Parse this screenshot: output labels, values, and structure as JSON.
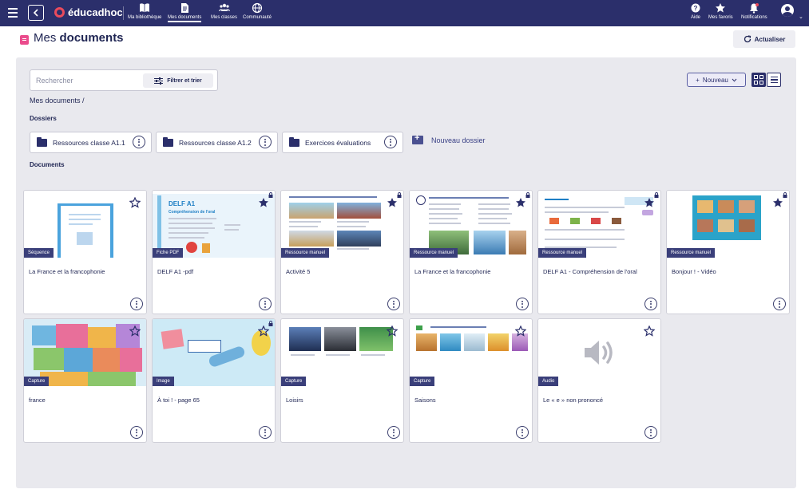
{
  "navbar": {
    "brand": "éducadhoc",
    "items": [
      {
        "label": "Ma bibliothèque",
        "icon": "book-icon"
      },
      {
        "label": "Mes documents",
        "icon": "document-icon"
      },
      {
        "label": "Mes classes",
        "icon": "users-icon"
      },
      {
        "label": "Communauté",
        "icon": "globe-icon"
      }
    ],
    "right_items": [
      {
        "label": "Aide",
        "icon": "help-icon"
      },
      {
        "label": "Mes favoris",
        "icon": "star-icon"
      },
      {
        "label": "Notifications",
        "icon": "bell-icon"
      }
    ]
  },
  "header": {
    "title_prefix": "Mes",
    "title_bold": "documents",
    "refresh_label": "Actualiser"
  },
  "toolbar": {
    "search_placeholder": "Rechercher",
    "filter_label": "Filtrer et trier",
    "new_label": "Nouveau"
  },
  "breadcrumb": "Mes documents /",
  "folders_section": "Dossiers",
  "folders": [
    {
      "name": "Ressources classe A1.1"
    },
    {
      "name": "Ressources classe A1.2"
    },
    {
      "name": "Exercices évaluations"
    }
  ],
  "new_folder_label": "Nouveau dossier",
  "documents_section": "Documents",
  "documents": [
    {
      "title": "La France et la francophonie",
      "badge": "Séquence",
      "starred": false,
      "locked": false
    },
    {
      "title": "DELF A1 -pdf",
      "badge": "Fiche PDF",
      "starred": true,
      "locked": true
    },
    {
      "title": "Activité 5",
      "badge": "Ressource manuel",
      "starred": true,
      "locked": true
    },
    {
      "title": "La France et la francophonie",
      "badge": "Ressource manuel",
      "starred": true,
      "locked": true
    },
    {
      "title": "DELF A1 - Compréhension de l'oral",
      "badge": "Ressource manuel",
      "starred": true,
      "locked": true
    },
    {
      "title": "Bonjour ! - Vidéo",
      "badge": "Ressource manuel",
      "starred": true,
      "locked": true
    },
    {
      "title": "france",
      "badge": "Capture",
      "starred": false,
      "locked": false
    },
    {
      "title": "À toi ! - page 65",
      "badge": "Image",
      "starred": false,
      "locked": true
    },
    {
      "title": "Loisirs",
      "badge": "Capture",
      "starred": false,
      "locked": false
    },
    {
      "title": "Saisons",
      "badge": "Capture",
      "starred": false,
      "locked": false
    },
    {
      "title": "Le « e » non prononcé",
      "badge": "Audio",
      "starred": false,
      "locked": false
    }
  ],
  "thumb_texts": {
    "delf_heading": "DELF A1",
    "delf_subheading": "Compréhension de l'oral"
  }
}
